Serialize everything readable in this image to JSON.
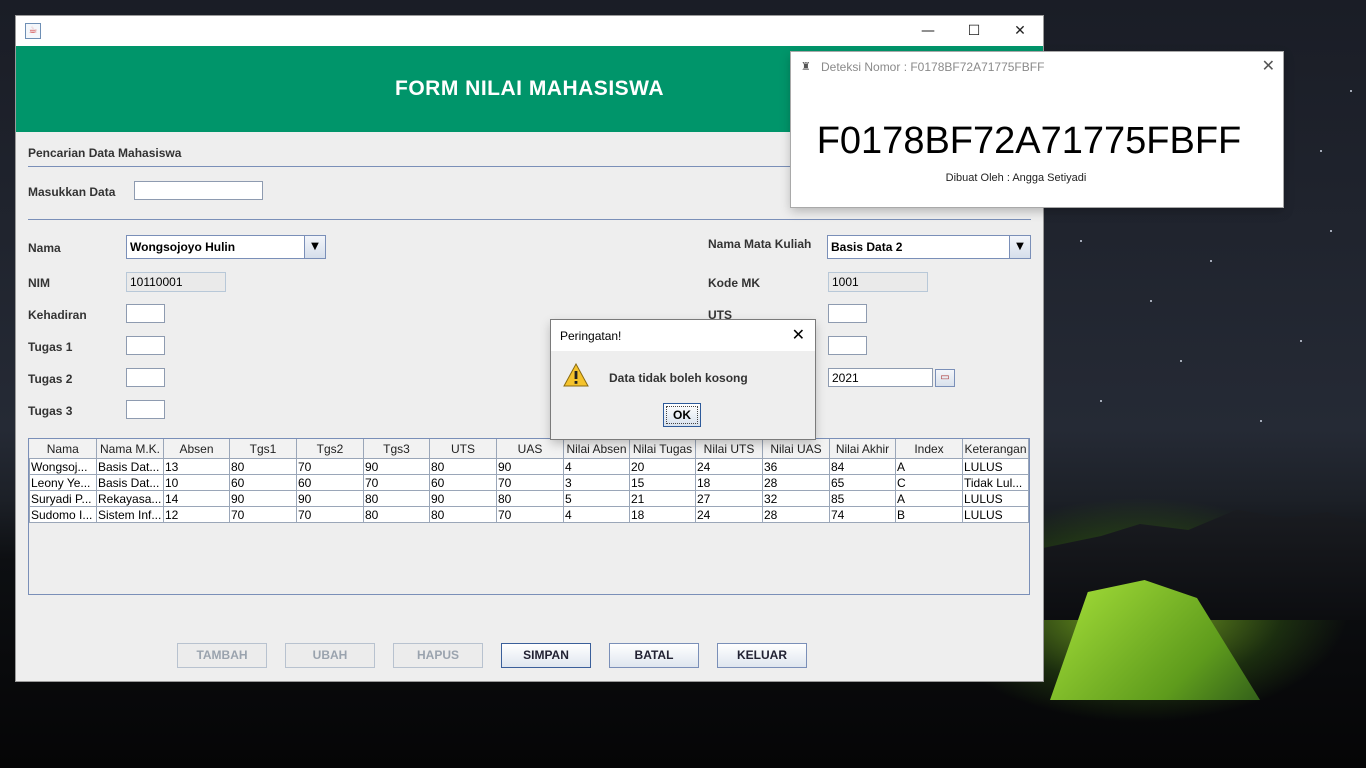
{
  "main_window": {
    "header_title": "FORM NILAI MAHASISWA",
    "minimize": "—",
    "maximize": "☐",
    "close": "✕",
    "search": {
      "section_label": "Pencarian Data Mahasiswa",
      "input_label": "Masukkan Data",
      "input_value": ""
    },
    "form": {
      "nama_label": "Nama",
      "nama_value": "Wongsojoyo Hulin",
      "nim_label": "NIM",
      "nim_value": "10110001",
      "kehadiran_label": "Kehadiran",
      "tugas1_label": "Tugas 1",
      "tugas2_label": "Tugas 2",
      "tugas3_label": "Tugas 3",
      "matkul_label": "Nama Mata Kuliah",
      "matkul_value": "Basis Data 2",
      "kode_label": "Kode MK",
      "kode_value": "1001",
      "uts_label": "UTS",
      "tahun_value": "2021"
    },
    "table": {
      "columns": [
        "Nama",
        "Nama M.K.",
        "Absen",
        "Tgs1",
        "Tgs2",
        "Tgs3",
        "UTS",
        "UAS",
        "Nilai Absen",
        "Nilai Tugas",
        "Nilai UTS",
        "Nilai UAS",
        "Nilai Akhir",
        "Index",
        "Keterangan"
      ],
      "rows": [
        [
          "Wongsoj...",
          "Basis Dat...",
          "13",
          "80",
          "70",
          "90",
          "80",
          "90",
          "4",
          "20",
          "24",
          "36",
          "84",
          "A",
          "LULUS"
        ],
        [
          "Leony Ye...",
          "Basis Dat...",
          "10",
          "60",
          "60",
          "70",
          "60",
          "70",
          "3",
          "15",
          "18",
          "28",
          "65",
          "C",
          "Tidak Lul..."
        ],
        [
          "Suryadi P...",
          "Rekayasa...",
          "14",
          "90",
          "90",
          "80",
          "90",
          "80",
          "5",
          "21",
          "27",
          "32",
          "85",
          "A",
          "LULUS"
        ],
        [
          "Sudomo I...",
          "Sistem Inf...",
          "12",
          "70",
          "70",
          "80",
          "80",
          "70",
          "4",
          "18",
          "24",
          "28",
          "74",
          "B",
          "LULUS"
        ]
      ]
    },
    "buttons": {
      "tambah": "TAMBAH",
      "ubah": "UBAH",
      "hapus": "HAPUS",
      "simpan": "SIMPAN",
      "batal": "BATAL",
      "keluar": "KELUAR"
    }
  },
  "deteksi_window": {
    "title": "Deteksi Nomor : F0178BF72A71775FBFF",
    "code": "F0178BF72A71775FBFF",
    "author": "Dibuat Oleh : Angga Setiyadi",
    "close": "✕"
  },
  "dialog": {
    "title": "Peringatan!",
    "message": "Data tidak boleh kosong",
    "ok": "OK",
    "close": "✕"
  },
  "colors": {
    "header_green": "#00956a",
    "accent_border": "#7a8fb8"
  }
}
